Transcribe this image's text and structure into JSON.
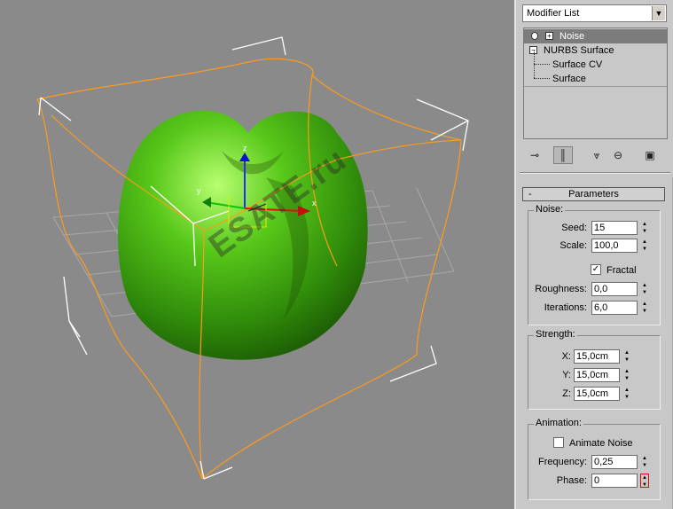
{
  "viewport": {
    "watermark": "ESATE.ru",
    "axis_x": "x",
    "axis_y": "y",
    "axis_z": "z"
  },
  "panel": {
    "modifier_list": "Modifier List",
    "stack": {
      "items": [
        "Noise",
        "NURBS Surface",
        "Surface CV",
        "Surface"
      ]
    },
    "parameters_title": "Parameters",
    "collapse_symbol": "-",
    "noise": {
      "group": "Noise:",
      "seed_label": "Seed:",
      "seed": "15",
      "scale_label": "Scale:",
      "scale": "100,0",
      "fractal_label": "Fractal",
      "roughness_label": "Roughness:",
      "roughness": "0,0",
      "iterations_label": "Iterations:",
      "iterations": "6,0"
    },
    "strength": {
      "group": "Strength:",
      "x_label": "X:",
      "x": "15,0cm",
      "y_label": "Y:",
      "y": "15,0cm",
      "z_label": "Z:",
      "z": "15,0cm"
    },
    "animation": {
      "group": "Animation:",
      "animate_label": "Animate Noise",
      "frequency_label": "Frequency:",
      "frequency": "0,25",
      "phase_label": "Phase:",
      "phase": "0"
    }
  }
}
